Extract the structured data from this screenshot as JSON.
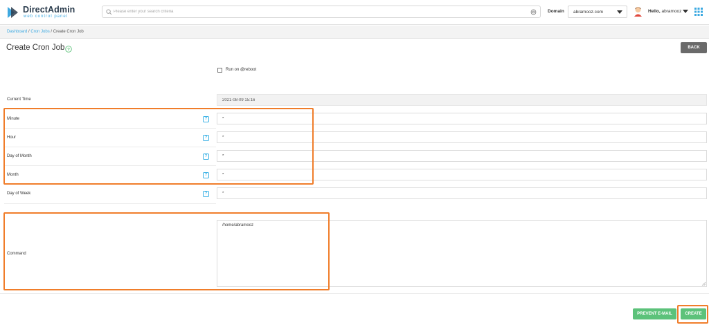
{
  "header": {
    "logo_title": "DirectAdmin",
    "logo_subtitle": "web control panel",
    "search_placeholder": "Please enter your search criteria",
    "domain_label": "Domain",
    "domain_value": "abramooz.com",
    "hello_prefix": "Hello,",
    "username": "abramooz"
  },
  "breadcrumb": {
    "items": [
      "Dashboard",
      "Cron Jobs",
      "Create Cron Job"
    ],
    "separator": " / "
  },
  "page": {
    "title": "Create Cron Job",
    "back_label": "BACK"
  },
  "form": {
    "reboot_label": "Run on @reboot",
    "reboot_checked": false,
    "current_time_label": "Current Time",
    "current_time_value": "2021-08-09 15:16",
    "help_glyph": "?",
    "minute_label": "Minute",
    "minute_value": "*",
    "hour_label": "Hour",
    "hour_value": "*",
    "dom_label": "Day of Month",
    "dom_value": "*",
    "month_label": "Month",
    "month_value": "*",
    "dow_label": "Day of Week",
    "dow_value": "*",
    "command_label": "Command",
    "command_value": "/home/abramooz"
  },
  "actions": {
    "prevent_email_label": "PREVENT E-MAIL",
    "create_label": "CREATE"
  },
  "colors": {
    "accent_blue": "#3ca9e1",
    "button_green": "#5cc27a",
    "back_gray": "#6a6a6a",
    "highlight_orange": "#f07d2a"
  },
  "icons": [
    "directadmin-logo-icon",
    "search-icon",
    "search-options-icon",
    "chevron-down-icon",
    "avatar-icon",
    "apps-grid-icon",
    "help-circle-icon",
    "help-square-icon",
    "resize-grip-icon"
  ]
}
